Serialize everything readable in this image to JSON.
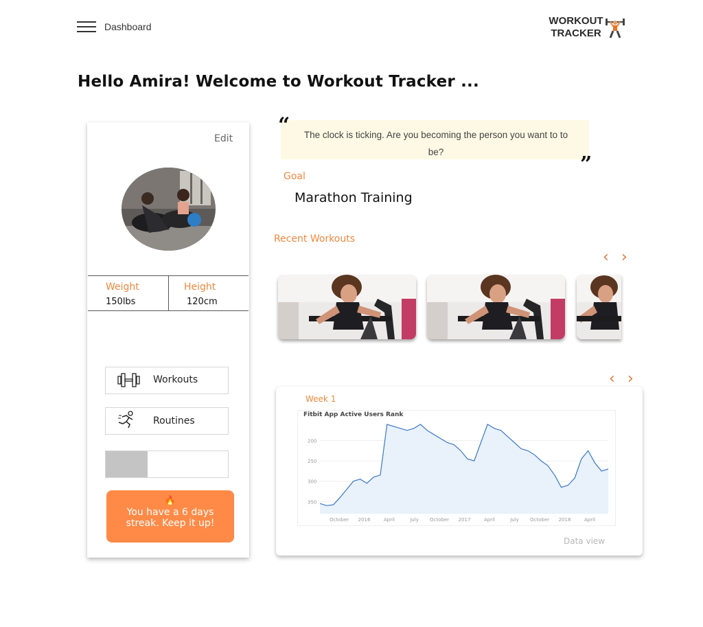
{
  "header": {
    "nav_label": "Dashboard",
    "logo_line1": "WORKOUT",
    "logo_line2": "TRACKER"
  },
  "greeting": "Hello Amira! Welcome to Workout Tracker ...",
  "profile": {
    "edit_label": "Edit",
    "weight_label": "Weight",
    "weight_value": "150lbs",
    "height_label": "Height",
    "height_value": "120cm"
  },
  "menu": {
    "workouts_label": "Workouts",
    "routines_label": "Routines",
    "progress_fraction": 0.34
  },
  "streak": {
    "icon": "fire-icon",
    "line1": "You have a 6 days",
    "line2": "streak. Keep it up!"
  },
  "quote": {
    "text": "The clock is ticking. Are you becoming the person you want to to be?"
  },
  "goal": {
    "label": "Goal",
    "value": "Marathon Training"
  },
  "recent_workouts": {
    "label": "Recent Workouts",
    "count_visible": 3
  },
  "chart_panel": {
    "week_label": "Week 1",
    "chart_title": "Fitbit App Active Users Rank",
    "data_view_label": "Data view"
  },
  "chart_data": {
    "type": "line",
    "title": "Fitbit App Active Users Rank",
    "x_ticks": [
      "October",
      "2016",
      "April",
      "July",
      "October",
      "2017",
      "April",
      "July",
      "October",
      "2018",
      "April"
    ],
    "y_ticks": [
      200,
      250,
      300,
      350
    ],
    "y_inverted": true,
    "ylim": [
      150,
      380
    ],
    "series": [
      {
        "values": [
          355,
          360,
          358,
          340,
          320,
          300,
          295,
          305,
          290,
          285,
          160,
          165,
          170,
          175,
          170,
          160,
          175,
          185,
          195,
          205,
          210,
          225,
          245,
          250,
          205,
          160,
          170,
          175,
          190,
          205,
          220,
          225,
          235,
          250,
          262,
          285,
          315,
          310,
          292,
          245,
          225,
          255,
          275,
          270
        ]
      }
    ]
  },
  "colors": {
    "accent": "#f0883e",
    "streak_bg": "#ff8a47",
    "quote_bg": "#fdf9e4",
    "chart_line": "#3a78c7"
  }
}
